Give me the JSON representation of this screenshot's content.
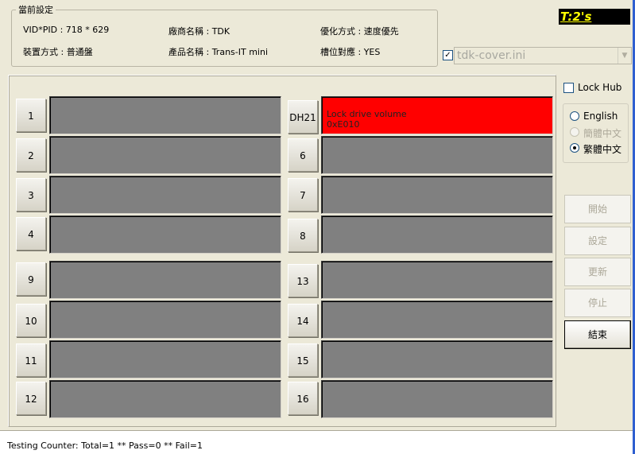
{
  "settings": {
    "legend": "當前設定",
    "vid_pid": "VID*PID :  718 * 629",
    "vendor": "廠商名稱 : TDK",
    "optimize": "優化方式 : 速度優先",
    "device_mode": "裝置方式 : 普通盤",
    "product": "產品名稱 : Trans-IT mini",
    "slot_mapping": "槽位對應 : YES"
  },
  "timer": "T:2's",
  "config": {
    "checked": true,
    "file": "tdk-cover.ini"
  },
  "ports": [
    {
      "label": "1",
      "line1": "",
      "line2": "",
      "status": "idle"
    },
    {
      "label": "DH21",
      "line1": "Lock drive volume",
      "line2": "0xE010",
      "status": "error"
    },
    {
      "label": "2",
      "line1": "",
      "line2": "",
      "status": "idle"
    },
    {
      "label": "6",
      "line1": "",
      "line2": "",
      "status": "idle"
    },
    {
      "label": "3",
      "line1": "",
      "line2": "",
      "status": "idle"
    },
    {
      "label": "7",
      "line1": "",
      "line2": "",
      "status": "idle"
    },
    {
      "label": "4",
      "line1": "",
      "line2": "",
      "status": "idle"
    },
    {
      "label": "8",
      "line1": "",
      "line2": "",
      "status": "idle"
    },
    {
      "label": "9",
      "line1": "",
      "line2": "",
      "status": "idle"
    },
    {
      "label": "13",
      "line1": "",
      "line2": "",
      "status": "idle"
    },
    {
      "label": "10",
      "line1": "",
      "line2": "",
      "status": "idle"
    },
    {
      "label": "14",
      "line1": "",
      "line2": "",
      "status": "idle"
    },
    {
      "label": "11",
      "line1": "",
      "line2": "",
      "status": "idle"
    },
    {
      "label": "15",
      "line1": "",
      "line2": "",
      "status": "idle"
    },
    {
      "label": "12",
      "line1": "",
      "line2": "",
      "status": "idle"
    },
    {
      "label": "16",
      "line1": "",
      "line2": "",
      "status": "idle"
    }
  ],
  "lock_hub": {
    "label": "Lock Hub",
    "checked": false
  },
  "language": {
    "options": [
      {
        "label": "English",
        "checked": false,
        "enabled": true
      },
      {
        "label": "簡體中文",
        "checked": false,
        "enabled": false
      },
      {
        "label": "繁體中文",
        "checked": true,
        "enabled": true
      }
    ]
  },
  "buttons": {
    "start": "開始",
    "settings": "設定",
    "refresh": "更新",
    "stop": "停止",
    "exit": "結束"
  },
  "status": "Testing Counter: Total=1 ** Pass=0 ** Fail=1",
  "colors": {
    "error": "#ff0000",
    "idle_slot": "#808080",
    "timer_text": "#ffff00"
  }
}
